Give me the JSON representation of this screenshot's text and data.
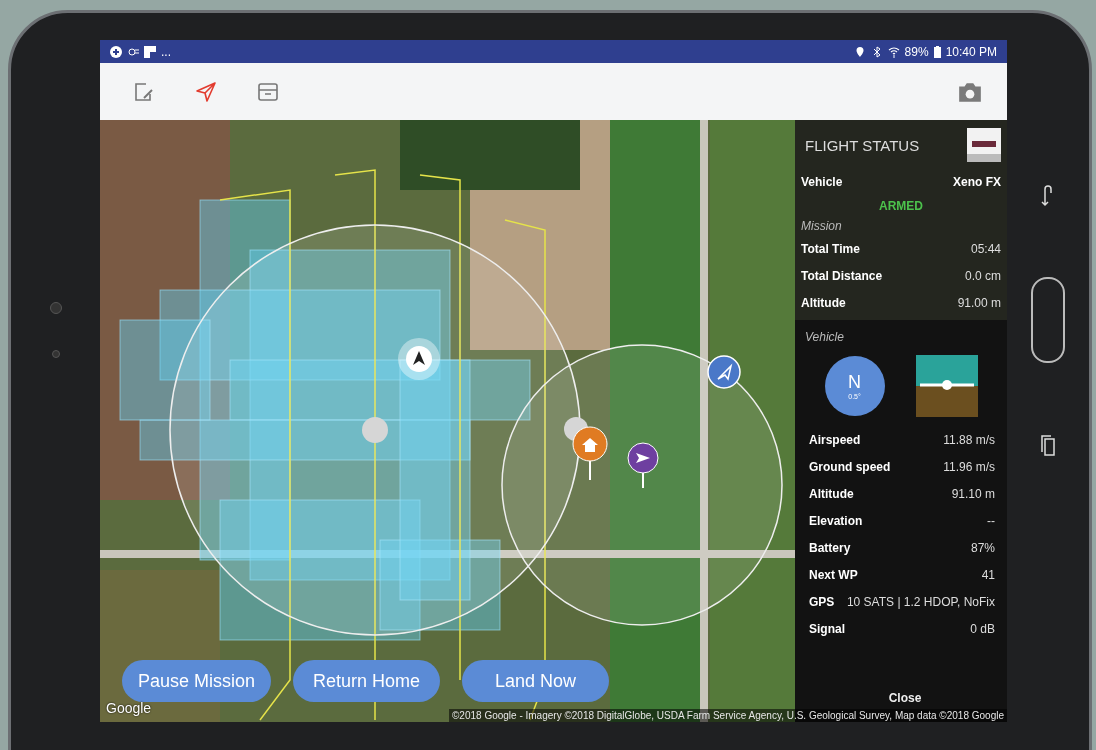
{
  "status_bar": {
    "left_text": "...",
    "battery": "89%",
    "time": "10:40 PM"
  },
  "toolbar": [
    {
      "kind": "edit",
      "selected": false
    },
    {
      "kind": "send",
      "selected": true
    },
    {
      "kind": "archive",
      "selected": false
    }
  ],
  "map": {
    "logo": "Google",
    "attribution": "©2018 Google - Imagery ©2018 DigitalGlobe, USDA Farm Service Agency, U.S. Geological Survey, Map data ©2018 Google"
  },
  "actions": [
    "Pause Mission",
    "Return Home",
    "Land Now"
  ],
  "flight_status": {
    "title": "FLIGHT STATUS",
    "vehicle_label": "Vehicle",
    "vehicle_value": "Xeno FX",
    "armed": "ARMED",
    "mission_heading": "Mission",
    "mission_rows": [
      {
        "label": "Total Time",
        "value": "05:44"
      },
      {
        "label": "Total Distance",
        "value": "0.0 cm"
      },
      {
        "label": "Altitude",
        "value": "91.00 m"
      }
    ],
    "vehicle_heading": "Vehicle",
    "compass_letter": "N",
    "compass_heading": "0.5°",
    "vehicle_rows": [
      {
        "label": "Airspeed",
        "value": "11.88 m/s"
      },
      {
        "label": "Ground speed",
        "value": "11.96 m/s"
      },
      {
        "label": "Altitude",
        "value": "91.10 m"
      },
      {
        "label": "Elevation",
        "value": "--"
      },
      {
        "label": "Battery",
        "value": "87%"
      },
      {
        "label": "Next WP",
        "value": "41"
      }
    ],
    "gps": {
      "label": "GPS",
      "value": "10 SATS | 1.2 HDOP, NoFix"
    },
    "signal": {
      "label": "Signal",
      "value": "0 dB"
    },
    "close": "Close"
  }
}
